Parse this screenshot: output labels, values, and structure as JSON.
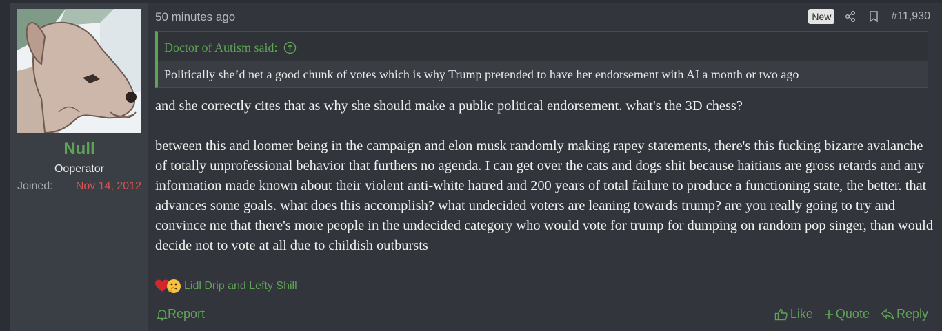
{
  "user": {
    "name": "Null",
    "title": "Ooperator",
    "joined_label": "Joined:",
    "joined_date": "Nov 14, 2012",
    "avatar_icon": "dog-avatar"
  },
  "post": {
    "timestamp": "50 minutes ago",
    "badge": "New",
    "number": "#11,930",
    "quote": {
      "author_line": "Doctor of Autism said:",
      "text": "Politically she’d net a good chunk of votes which is why Trump pretended to have her endorsement with AI a month or two ago"
    },
    "paragraphs": [
      "and she correctly cites that as why she should make a public political endorsement. what's the 3D chess?",
      "between this and loomer being in the campaign and elon musk randomly making rapey statements, there's this fucking bizarre avalanche of totally unprofessional behavior that furthers no agenda. I can get over the cats and dogs shit because haitians are gross retards and any information made known about their violent anti-white hatred and 200 years of total failure to produce a functioning state, the better. that advances some goals. what does this accomplish? what undecided voters are leaning towards trump? are you really going to try and convince me that there's more people in the undecided category who would vote for trump for dumping on random pop singer, than would decide not to vote at all due to childish outbursts"
    ],
    "reactions": {
      "icons": [
        "heart-icon",
        "thinking-emoji-icon"
      ],
      "names": "Lidl Drip and Lefty Shill"
    }
  },
  "actions": {
    "report": "Report",
    "like": "Like",
    "quote": "Quote",
    "reply": "Reply"
  },
  "colors": {
    "accent_green": "#5fa356",
    "joined_red": "#d9534f",
    "background": "#2b2e34",
    "post_bg": "#32353b",
    "user_col_bg": "#3a3e45"
  }
}
